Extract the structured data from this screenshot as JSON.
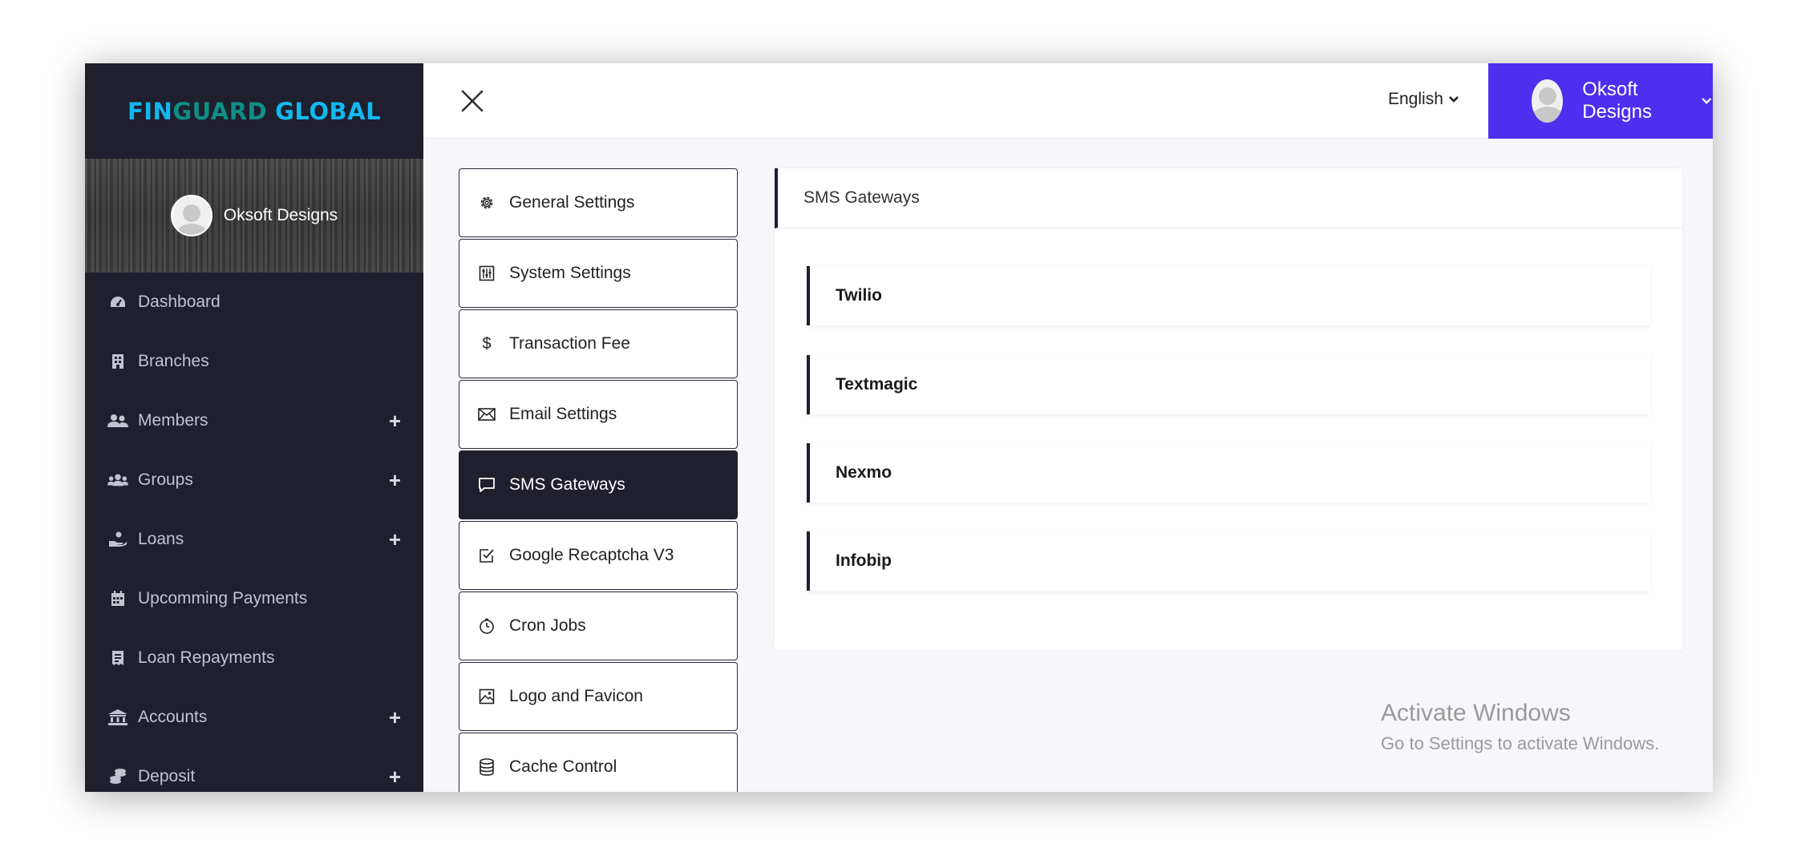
{
  "brand": {
    "part1": "FIN",
    "part2": "GUARD",
    "part3": "GLOBAL"
  },
  "sidebar_user": {
    "name": "Oksoft Designs"
  },
  "nav": [
    {
      "label": "Dashboard",
      "icon": "tachometer-icon",
      "expandable": false
    },
    {
      "label": "Branches",
      "icon": "building-icon",
      "expandable": false
    },
    {
      "label": "Members",
      "icon": "users-icon",
      "expandable": true
    },
    {
      "label": "Groups",
      "icon": "group-icon",
      "expandable": true
    },
    {
      "label": "Loans",
      "icon": "hand-money-icon",
      "expandable": true
    },
    {
      "label": "Upcomming Payments",
      "icon": "calendar-icon",
      "expandable": false
    },
    {
      "label": "Loan Repayments",
      "icon": "receipt-icon",
      "expandable": false
    },
    {
      "label": "Accounts",
      "icon": "bank-icon",
      "expandable": true
    },
    {
      "label": "Deposit",
      "icon": "coins-icon",
      "expandable": true
    }
  ],
  "topbar": {
    "language": "English",
    "user_name": "Oksoft Designs"
  },
  "settings_menu": [
    {
      "label": "General Settings",
      "icon": "gear-icon",
      "active": false
    },
    {
      "label": "System Settings",
      "icon": "sliders-icon",
      "active": false
    },
    {
      "label": "Transaction Fee",
      "icon": "dollar-icon",
      "active": false
    },
    {
      "label": "Email Settings",
      "icon": "envelope-icon",
      "active": false
    },
    {
      "label": "SMS Gateways",
      "icon": "chat-icon",
      "active": true
    },
    {
      "label": "Google Recaptcha V3",
      "icon": "checkbox-icon",
      "active": false
    },
    {
      "label": "Cron Jobs",
      "icon": "clock-icon",
      "active": false
    },
    {
      "label": "Logo and Favicon",
      "icon": "image-icon",
      "active": false
    },
    {
      "label": "Cache Control",
      "icon": "database-icon",
      "active": false
    }
  ],
  "main": {
    "title": "SMS Gateways",
    "gateways": [
      "Twilio",
      "Textmagic",
      "Nexmo",
      "Infobip"
    ]
  },
  "watermark": {
    "title": "Activate Windows",
    "subtitle": "Go to Settings to activate Windows."
  }
}
